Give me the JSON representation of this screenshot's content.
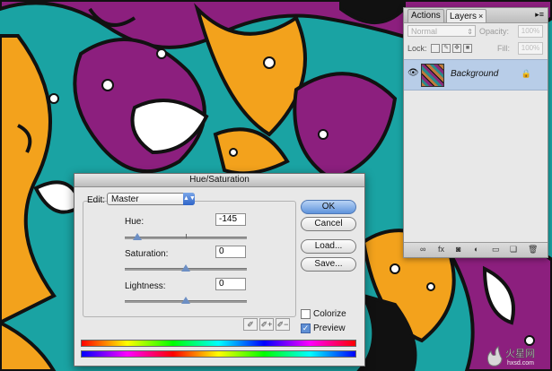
{
  "layers_panel": {
    "tabs": [
      {
        "label": "Actions",
        "active": false
      },
      {
        "label": "Layers",
        "active": true
      }
    ],
    "close_glyph": "×",
    "blend_mode": "Normal",
    "opacity_label": "Opacity:",
    "opacity_value": "100%",
    "lock_label": "Lock:",
    "fill_label": "Fill:",
    "fill_value": "100%",
    "layer": {
      "name": "Background",
      "visible": true,
      "locked": true
    },
    "bottom_icons": [
      "link-icon",
      "fx-icon",
      "mask-icon",
      "adjustment-icon",
      "group-icon",
      "new-layer-icon",
      "trash-icon"
    ]
  },
  "dialog": {
    "title": "Hue/Saturation",
    "edit_label": "Edit:",
    "edit_value": "Master",
    "hue_label": "Hue:",
    "hue_value": "-145",
    "hue_level": 0.1,
    "saturation_label": "Saturation:",
    "saturation_value": "0",
    "saturation_level": 0.5,
    "lightness_label": "Lightness:",
    "lightness_value": "0",
    "lightness_level": 0.5,
    "buttons": {
      "ok": "OK",
      "cancel": "Cancel",
      "load": "Load...",
      "save": "Save..."
    },
    "colorize_label": "Colorize",
    "colorize_checked": false,
    "preview_label": "Preview",
    "preview_checked": true
  },
  "watermark": {
    "text": "火星网",
    "subtext": "hxsd.com"
  },
  "colors": {
    "teal": "#1aa3a3",
    "magenta": "#8c1f7e",
    "orange": "#f3a21c",
    "black": "#111111",
    "white": "#ffffff",
    "selected_layer": "#b8cde8"
  }
}
